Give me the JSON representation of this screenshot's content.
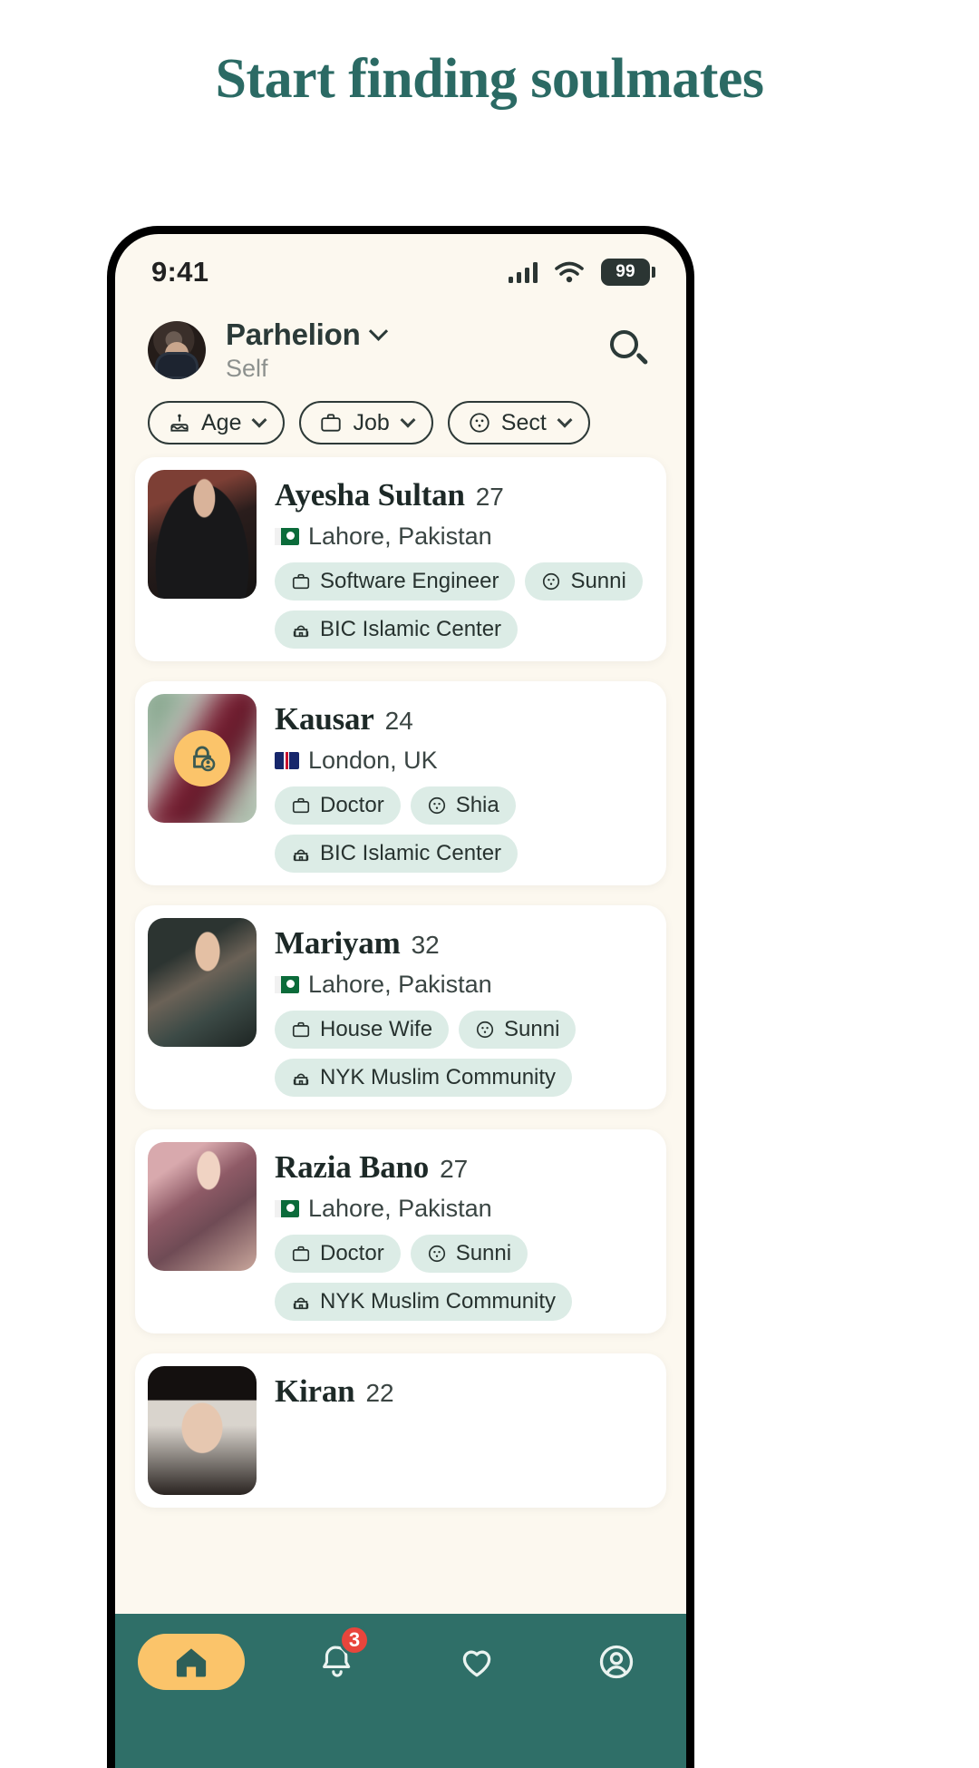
{
  "headline": "Start finding soulmates",
  "status": {
    "time": "9:41",
    "battery": "99",
    "signal_icon": "signal-bars-icon",
    "wifi_icon": "wifi-icon"
  },
  "header": {
    "user_name": "Parhelion",
    "user_role": "Self",
    "avatar_icon": "user-avatar",
    "dropdown_icon": "chevron-down-icon",
    "search_icon": "search-icon"
  },
  "filters": [
    {
      "label": "Age",
      "icon": "cake-icon",
      "chevron": "chevron-down-icon"
    },
    {
      "label": "Job",
      "icon": "briefcase-icon",
      "chevron": "chevron-down-icon"
    },
    {
      "label": "Sect",
      "icon": "sect-icon",
      "chevron": "chevron-down-icon"
    }
  ],
  "profiles": [
    {
      "name": "Ayesha Sultan",
      "age": "27",
      "location": "Lahore, Pakistan",
      "flag": "pk",
      "job": "Software Engineer",
      "sect": "Sunni",
      "community": "BIC Islamic Center",
      "locked": false
    },
    {
      "name": "Kausar",
      "age": "24",
      "location": "London, UK",
      "flag": "uk",
      "job": "Doctor",
      "sect": "Shia",
      "community": "BIC Islamic Center",
      "locked": true,
      "lock_icon": "lock-person-icon"
    },
    {
      "name": "Mariyam",
      "age": "32",
      "location": "Lahore, Pakistan",
      "flag": "pk",
      "job": "House Wife",
      "sect": "Sunni",
      "community": "NYK Muslim Community",
      "locked": false
    },
    {
      "name": "Razia Bano",
      "age": "27",
      "location": "Lahore, Pakistan",
      "flag": "pk",
      "job": "Doctor",
      "sect": "Sunni",
      "community": "NYK Muslim Community",
      "locked": false
    },
    {
      "name": "Kiran",
      "age": "22",
      "location": "",
      "flag": "pk",
      "job": "",
      "sect": "",
      "community": "",
      "locked": false
    }
  ],
  "bottom_nav": [
    {
      "name": "home",
      "icon": "home-icon",
      "active": true,
      "badge": ""
    },
    {
      "name": "notifications",
      "icon": "bell-icon",
      "active": false,
      "badge": "3"
    },
    {
      "name": "favorites",
      "icon": "heart-icon",
      "active": false,
      "badge": ""
    },
    {
      "name": "profile",
      "icon": "user-circle-icon",
      "active": false,
      "badge": ""
    }
  ],
  "colors": {
    "brand_teal": "#2b6a64",
    "nav_teal": "#2f6f68",
    "accent_amber": "#fbc46a",
    "tag_mint": "#dcece6",
    "badge_red": "#e8453c",
    "screen_bg": "#fcf8ef"
  }
}
